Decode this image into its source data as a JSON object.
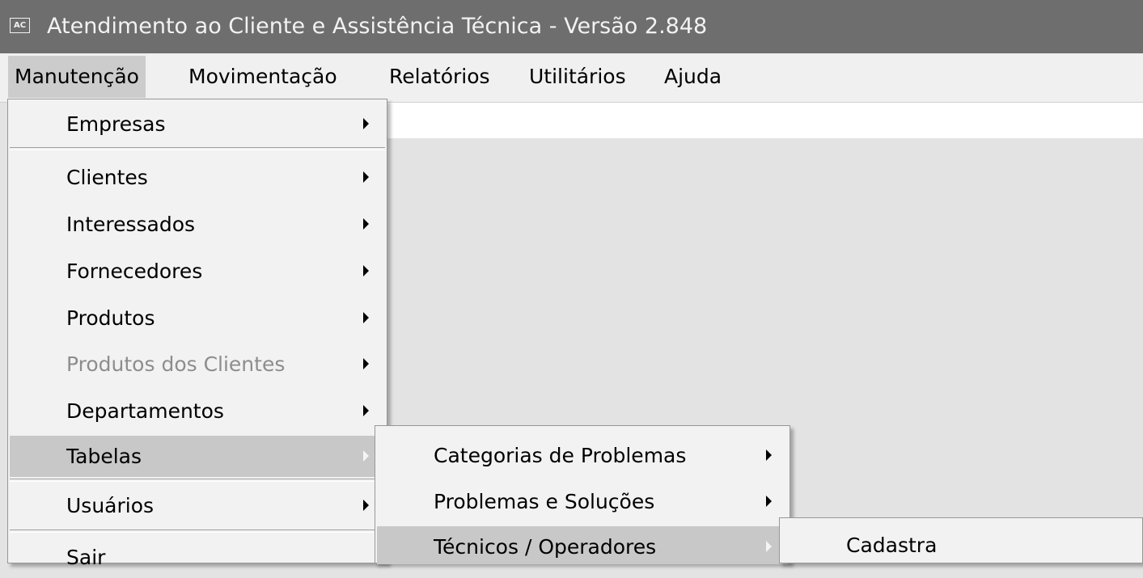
{
  "window": {
    "title": "Atendimento ao Cliente e Assistência Técnica - Versão 2.848",
    "icon_text": "AC"
  },
  "menubar": {
    "items": [
      {
        "label": "Manutenção",
        "active": true
      },
      {
        "label": "Movimentação"
      },
      {
        "label": "Relatórios"
      },
      {
        "label": "Utilitários"
      },
      {
        "label": "Ajuda"
      }
    ]
  },
  "manutencao_menu": {
    "items": [
      {
        "label": "Empresas",
        "submenu": true
      },
      {
        "label": "Clientes",
        "submenu": true
      },
      {
        "label": "Interessados",
        "submenu": true
      },
      {
        "label": "Fornecedores",
        "submenu": true
      },
      {
        "label": "Produtos",
        "submenu": true
      },
      {
        "label": "Produtos dos Clientes",
        "submenu": true,
        "disabled": true
      },
      {
        "label": "Departamentos",
        "submenu": true
      },
      {
        "label": "Tabelas",
        "submenu": true,
        "active": true
      },
      {
        "label": "Usuários",
        "submenu": true
      },
      {
        "label": "Sair"
      }
    ]
  },
  "tabelas_submenu": {
    "items": [
      {
        "label": "Categorias de Problemas",
        "submenu": true
      },
      {
        "label": "Problemas e Soluções",
        "submenu": true
      },
      {
        "label": "Técnicos / Operadores",
        "submenu": true,
        "active": true
      }
    ]
  },
  "tecnicos_submenu": {
    "items": [
      {
        "label": "Cadastra"
      }
    ]
  },
  "colors": {
    "titlebar": "#6e6e6e",
    "menu_background": "#f2f2f2",
    "highlight": "#c8c8c8",
    "disabled_text": "#8d8d8d"
  }
}
